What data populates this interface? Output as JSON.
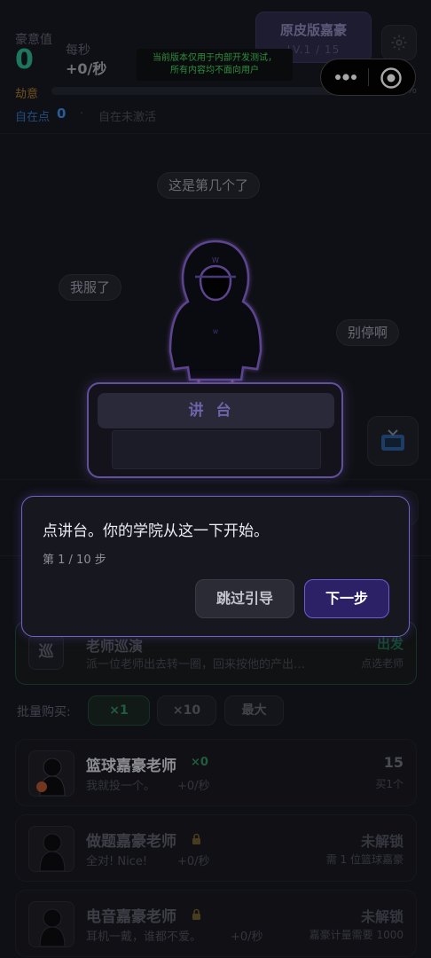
{
  "stats": {
    "currency_label": "豪意值",
    "currency_value": "0",
    "rate_label": "每秒",
    "rate_value": "+0/秒",
    "stamina_label": "劫意",
    "progress_pct": "0%",
    "progress_fraction": 0,
    "points_label": "自在点",
    "points_value": "0",
    "points_sep": "·",
    "points_status": "自在未激活"
  },
  "version": {
    "title": "原皮版嘉豪",
    "level": "LV.1  /  15"
  },
  "dev_notice": {
    "line1": "当前版本仅用于内部开发测试，",
    "line2": "所有内容均不面向用户"
  },
  "icons": {
    "gear": "gear-icon",
    "more": "more-dots-icon",
    "target": "target-icon",
    "tv": "tv-icon",
    "lock": "lock-icon"
  },
  "bubbles": {
    "top": "这是第几个了",
    "left": "我服了",
    "right": "别停啊"
  },
  "podium": {
    "label": "讲台"
  },
  "guide": {
    "text": "点讲台。你的学院从这一下开始。",
    "step": "第 1 / 10 步",
    "skip_label": "跳过引导",
    "next_label": "下一步"
  },
  "patrol": {
    "icon_text": "巡",
    "title": "老师巡演",
    "desc": "派一位老师出去转一圈，回来按他的产出…",
    "action": "出发",
    "hint": "点选老师"
  },
  "batch": {
    "label": "批量购买:",
    "options": [
      "×1",
      "×10",
      "最大"
    ]
  },
  "teachers": [
    {
      "name": "篮球嘉豪老师",
      "badge": "×0",
      "desc": "我就投一个。",
      "rate": "+0/秒",
      "right1": "15",
      "right2": "买1个"
    },
    {
      "name": "做题嘉豪老师",
      "badge": "",
      "desc": "全对! Nice!",
      "rate": "+0/秒",
      "right1": "未解锁",
      "right2": "需 1 位篮球嘉豪"
    },
    {
      "name": "电音嘉豪老师",
      "badge": "",
      "desc": "耳机一戴，谁都不爱。",
      "rate": "+0/秒",
      "right1": "未解锁",
      "right2": "嘉豪计量需要 1000"
    }
  ],
  "colors": {
    "accent_green": "#2bb38c",
    "accent_purple": "#9478e8",
    "background": "#15161c"
  }
}
